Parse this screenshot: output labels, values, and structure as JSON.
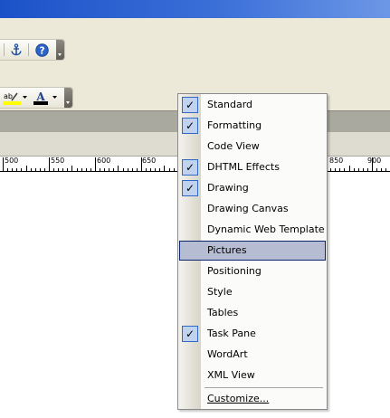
{
  "toolbar_top": {
    "icons": [
      "anchor-icon",
      "help-icon"
    ],
    "grip_label": "toolbar-options"
  },
  "toolbar_format": {
    "icons": [
      "highlight-icon",
      "font-color-icon"
    ],
    "highlight_glyph": "ab",
    "font_color_glyph": "A",
    "highlight_color": "#ffff00",
    "font_color": "#000000"
  },
  "ruler": {
    "labels": [
      "500",
      "550",
      "600",
      "650",
      "850",
      "900"
    ]
  },
  "context_menu": {
    "items": [
      {
        "label": "Standard",
        "checked": true
      },
      {
        "label": "Formatting",
        "checked": true
      },
      {
        "label": "Code View",
        "checked": false
      },
      {
        "label": "DHTML Effects",
        "checked": true
      },
      {
        "label": "Drawing",
        "checked": true
      },
      {
        "label": "Drawing Canvas",
        "checked": false
      },
      {
        "label": "Dynamic Web Template",
        "checked": false
      },
      {
        "label": "Pictures",
        "checked": false,
        "highlighted": true
      },
      {
        "label": "Positioning",
        "checked": false
      },
      {
        "label": "Style",
        "checked": false
      },
      {
        "label": "Tables",
        "checked": false
      },
      {
        "label": "Task Pane",
        "checked": true
      },
      {
        "label": "WordArt",
        "checked": false
      },
      {
        "label": "XML View",
        "checked": false
      }
    ],
    "customize_label": "Customize...",
    "check_glyph": "✓",
    "highlight_color": "#b6bdd2"
  }
}
